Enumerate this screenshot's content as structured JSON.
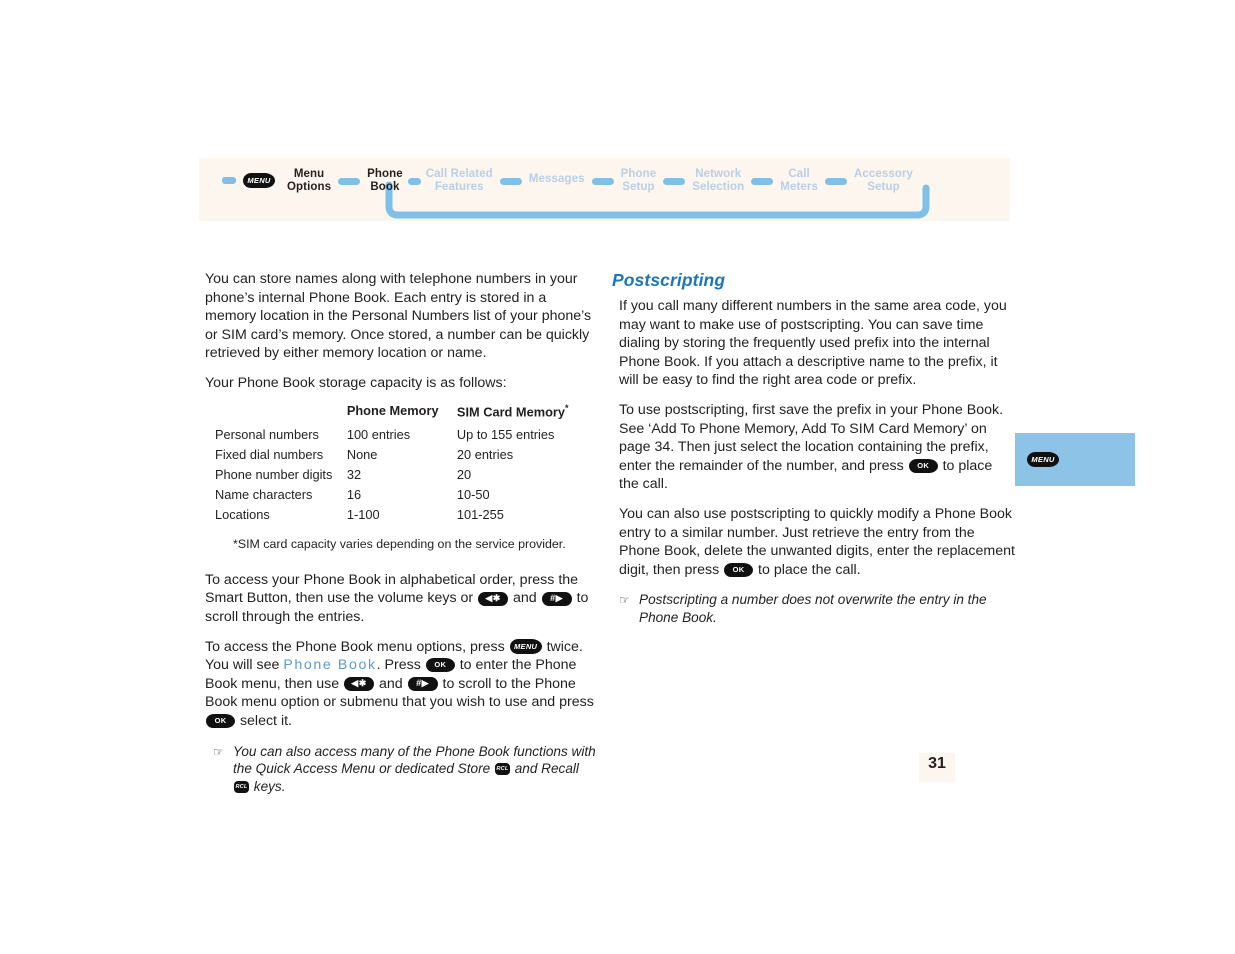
{
  "header": {
    "background_color": "#fdf6ef",
    "connector_color": "#7fc0e8",
    "inactive_color": "#b9cfe8",
    "menu_key_label": "MENU",
    "breadcrumbs": [
      {
        "line1": "Menu",
        "line2": "Options",
        "state": "active"
      },
      {
        "line1": "Phone",
        "line2": "Book",
        "state": "active"
      },
      {
        "line1": "Call Related",
        "line2": "Features",
        "state": "inactive"
      },
      {
        "line1": "Messages",
        "line2": "",
        "state": "inactive"
      },
      {
        "line1": "Phone",
        "line2": "Setup",
        "state": "inactive"
      },
      {
        "line1": "Network",
        "line2": "Selection",
        "state": "inactive"
      },
      {
        "line1": "Call",
        "line2": "Meters",
        "state": "inactive"
      },
      {
        "line1": "Accessory",
        "line2": "Setup",
        "state": "inactive"
      }
    ]
  },
  "left_column": {
    "intro_paragraph": "You can store names along with telephone numbers in your phone’s internal Phone Book. Each entry is stored in a memory location in the Personal Numbers list of your phone’s or SIM card’s memory. Once stored, a number can be quickly retrieved by either memory location or name.",
    "capacity_lead": "Your Phone Book storage capacity is as follows:",
    "table": {
      "headers": [
        "",
        "Phone Memory",
        "SIM Card Memory"
      ],
      "header_superscript": "*",
      "rows": [
        {
          "label": "Personal numbers",
          "phone": "100 entries",
          "sim": "Up to 155 entries"
        },
        {
          "label": "Fixed dial numbers",
          "phone": "None",
          "sim": "20 entries"
        },
        {
          "label": "Phone number digits",
          "phone": "32",
          "sim": "20"
        },
        {
          "label": "Name characters",
          "phone": "16",
          "sim": "10-50"
        },
        {
          "label": "Locations",
          "phone": "1-100",
          "sim": "101-255"
        }
      ]
    },
    "footnote": "*SIM card capacity varies depending on the service provider.",
    "alpha_access_part1": "To access your Phone Book in alphabetical order, press the Smart Button, then use the volume keys or ",
    "alpha_access_part2": " and ",
    "alpha_access_part3": " to scroll through the entries.",
    "menu_access_part1": "To access the Phone Book menu options, press ",
    "menu_access_part2": " twice. You will see ",
    "menu_access_lcd": "Phone Book",
    "menu_access_part3": ". Press ",
    "menu_access_part4": " to enter the Phone Book menu, then use ",
    "menu_access_part5": " and ",
    "menu_access_part6": " to scroll to the Phone Book menu option or submenu that you wish to use and press ",
    "menu_access_part7": " select it.",
    "note_part1": "You can also access many of the Phone Book functions with the Quick Access Menu or dedicated Store ",
    "note_part2": " and Recall ",
    "note_part3": " keys."
  },
  "right_column": {
    "heading": "Postscripting",
    "paragraph1": "If you call many different numbers in the same area code, you may want to make use of postscripting. You can save time dialing by storing the frequently used prefix into the internal Phone Book. If you attach a descriptive name to the prefix, it will be easy to find the right area code or prefix.",
    "paragraph2_part1": "To use postscripting, first save the prefix in your Phone Book. See ‘Add To Phone Memory, Add To SIM Card Memory’ on page 34. Then just select the location containing the prefix, enter the remainder of the number, and press ",
    "paragraph2_part2": " to place the call.",
    "paragraph3_part1": "You can also use postscripting to quickly modify a Phone Book entry to a similar number. Just retrieve the entry from the Phone Book, delete the unwanted digits, enter the replacement digit, then press ",
    "paragraph3_part2": " to place the call.",
    "note": "Postscripting a number does not overwrite the entry in the Phone Book."
  },
  "keys": {
    "menu": "MENU",
    "ok": "OK",
    "star": "◀✱",
    "hash": "#▶",
    "rcl": "RCL",
    "hand_icon": "☞"
  },
  "side_tab": {
    "color": "#8ec3e8",
    "key_label": "MENU"
  },
  "page": {
    "number": "31"
  }
}
